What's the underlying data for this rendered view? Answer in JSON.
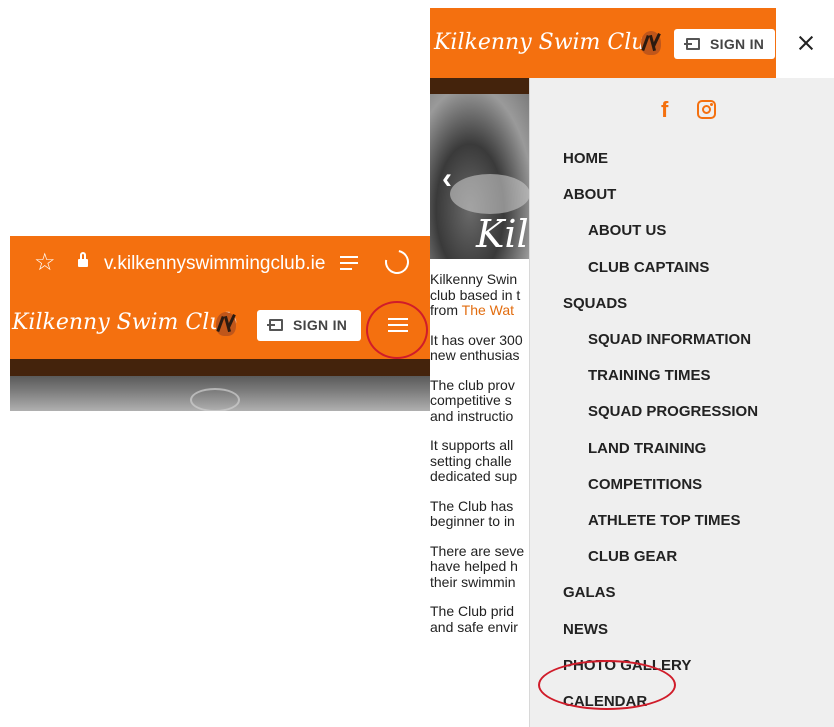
{
  "left_phone": {
    "url": "v.kilkennyswimmingclub.ie",
    "logo_text": "Kilkenny Swim Club",
    "sign_in_label": "SIGN IN"
  },
  "right_phone": {
    "logo_text": "Kilkenny Swim Club",
    "sign_in_label": "SIGN IN",
    "hero_text": "Kil",
    "body_paragraphs": [
      {
        "text": "Kilkenny Swin\nclub based in t\nfrom ",
        "link": "The Wat"
      },
      {
        "text": "It has over 300\nnew enthusias"
      },
      {
        "text": "The club prov\ncompetitive s\nand instructio"
      },
      {
        "text": "It supports all\nsetting challe\ndedicated sup"
      },
      {
        "text": "The Club has\nbeginner to in"
      },
      {
        "text": "There are seve\nhave helped h\ntheir swimmin"
      },
      {
        "text": "The Club prid\nand safe envir"
      }
    ],
    "menu": [
      {
        "label": "HOME",
        "level": "top"
      },
      {
        "label": "ABOUT",
        "level": "top"
      },
      {
        "label": "ABOUT US",
        "level": "sub"
      },
      {
        "label": "CLUB CAPTAINS",
        "level": "sub"
      },
      {
        "label": "SQUADS",
        "level": "top"
      },
      {
        "label": "SQUAD INFORMATION",
        "level": "sub"
      },
      {
        "label": "TRAINING TIMES",
        "level": "sub"
      },
      {
        "label": "SQUAD PROGRESSION",
        "level": "sub"
      },
      {
        "label": "LAND TRAINING",
        "level": "sub"
      },
      {
        "label": "COMPETITIONS",
        "level": "sub"
      },
      {
        "label": "ATHLETE TOP TIMES",
        "level": "sub"
      },
      {
        "label": "CLUB GEAR",
        "level": "sub"
      },
      {
        "label": "GALAS",
        "level": "top"
      },
      {
        "label": "NEWS",
        "level": "top"
      },
      {
        "label": "PHOTO GALLERY",
        "level": "top"
      },
      {
        "label": "CALENDAR",
        "level": "top"
      }
    ]
  },
  "colors": {
    "brand_orange": "#f4700f",
    "dark_band": "#44230c",
    "highlight_circle": "#d01c2a",
    "drawer_bg": "#efefef"
  },
  "icons": [
    "star-icon",
    "lock-icon",
    "reader-mode-icon",
    "reload-icon",
    "tiger-logo-icon",
    "sign-in-icon",
    "hamburger-menu-icon",
    "close-icon",
    "facebook-icon",
    "instagram-icon",
    "chevron-left-icon"
  ]
}
